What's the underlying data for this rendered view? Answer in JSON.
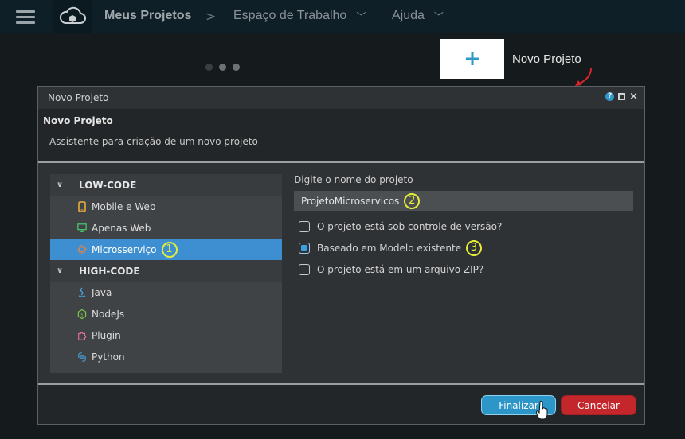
{
  "topbar": {
    "title": "Meus Projetos",
    "sep": ">",
    "workspace": "Espaço de Trabalho",
    "help": "Ajuda",
    "chevron": "﹀"
  },
  "new_project": {
    "plus": "+",
    "label": "Novo Projeto"
  },
  "dialog": {
    "title": "Novo Projeto",
    "header_title": "Novo Projeto",
    "header_subtitle": "Assistente para criação de um novo projeto",
    "tree": {
      "low_code": {
        "label": "LOW-CODE",
        "items": [
          "Mobile e Web",
          "Apenas Web",
          "Microsserviço"
        ]
      },
      "high_code": {
        "label": "HIGH-CODE",
        "items": [
          "Java",
          "NodeJs",
          "Plugin",
          "Python"
        ]
      }
    },
    "form": {
      "name_label": "Digite o nome do projeto",
      "name_value": "ProjetoMicroservicos",
      "checks": [
        {
          "label": "O projeto está sob controle de versão?",
          "checked": false
        },
        {
          "label": "Baseado em Modelo existente",
          "checked": true
        },
        {
          "label": "O projeto está em um arquivo ZIP?",
          "checked": false
        }
      ]
    },
    "badges": [
      "1",
      "2",
      "3"
    ],
    "buttons": {
      "finish": "Finalizar",
      "cancel": "Cancelar"
    }
  },
  "colors": {
    "accent": "#2c96c9",
    "selected": "#3e8fd1",
    "danger": "#c3272c",
    "badge": "#e4ec3a"
  }
}
